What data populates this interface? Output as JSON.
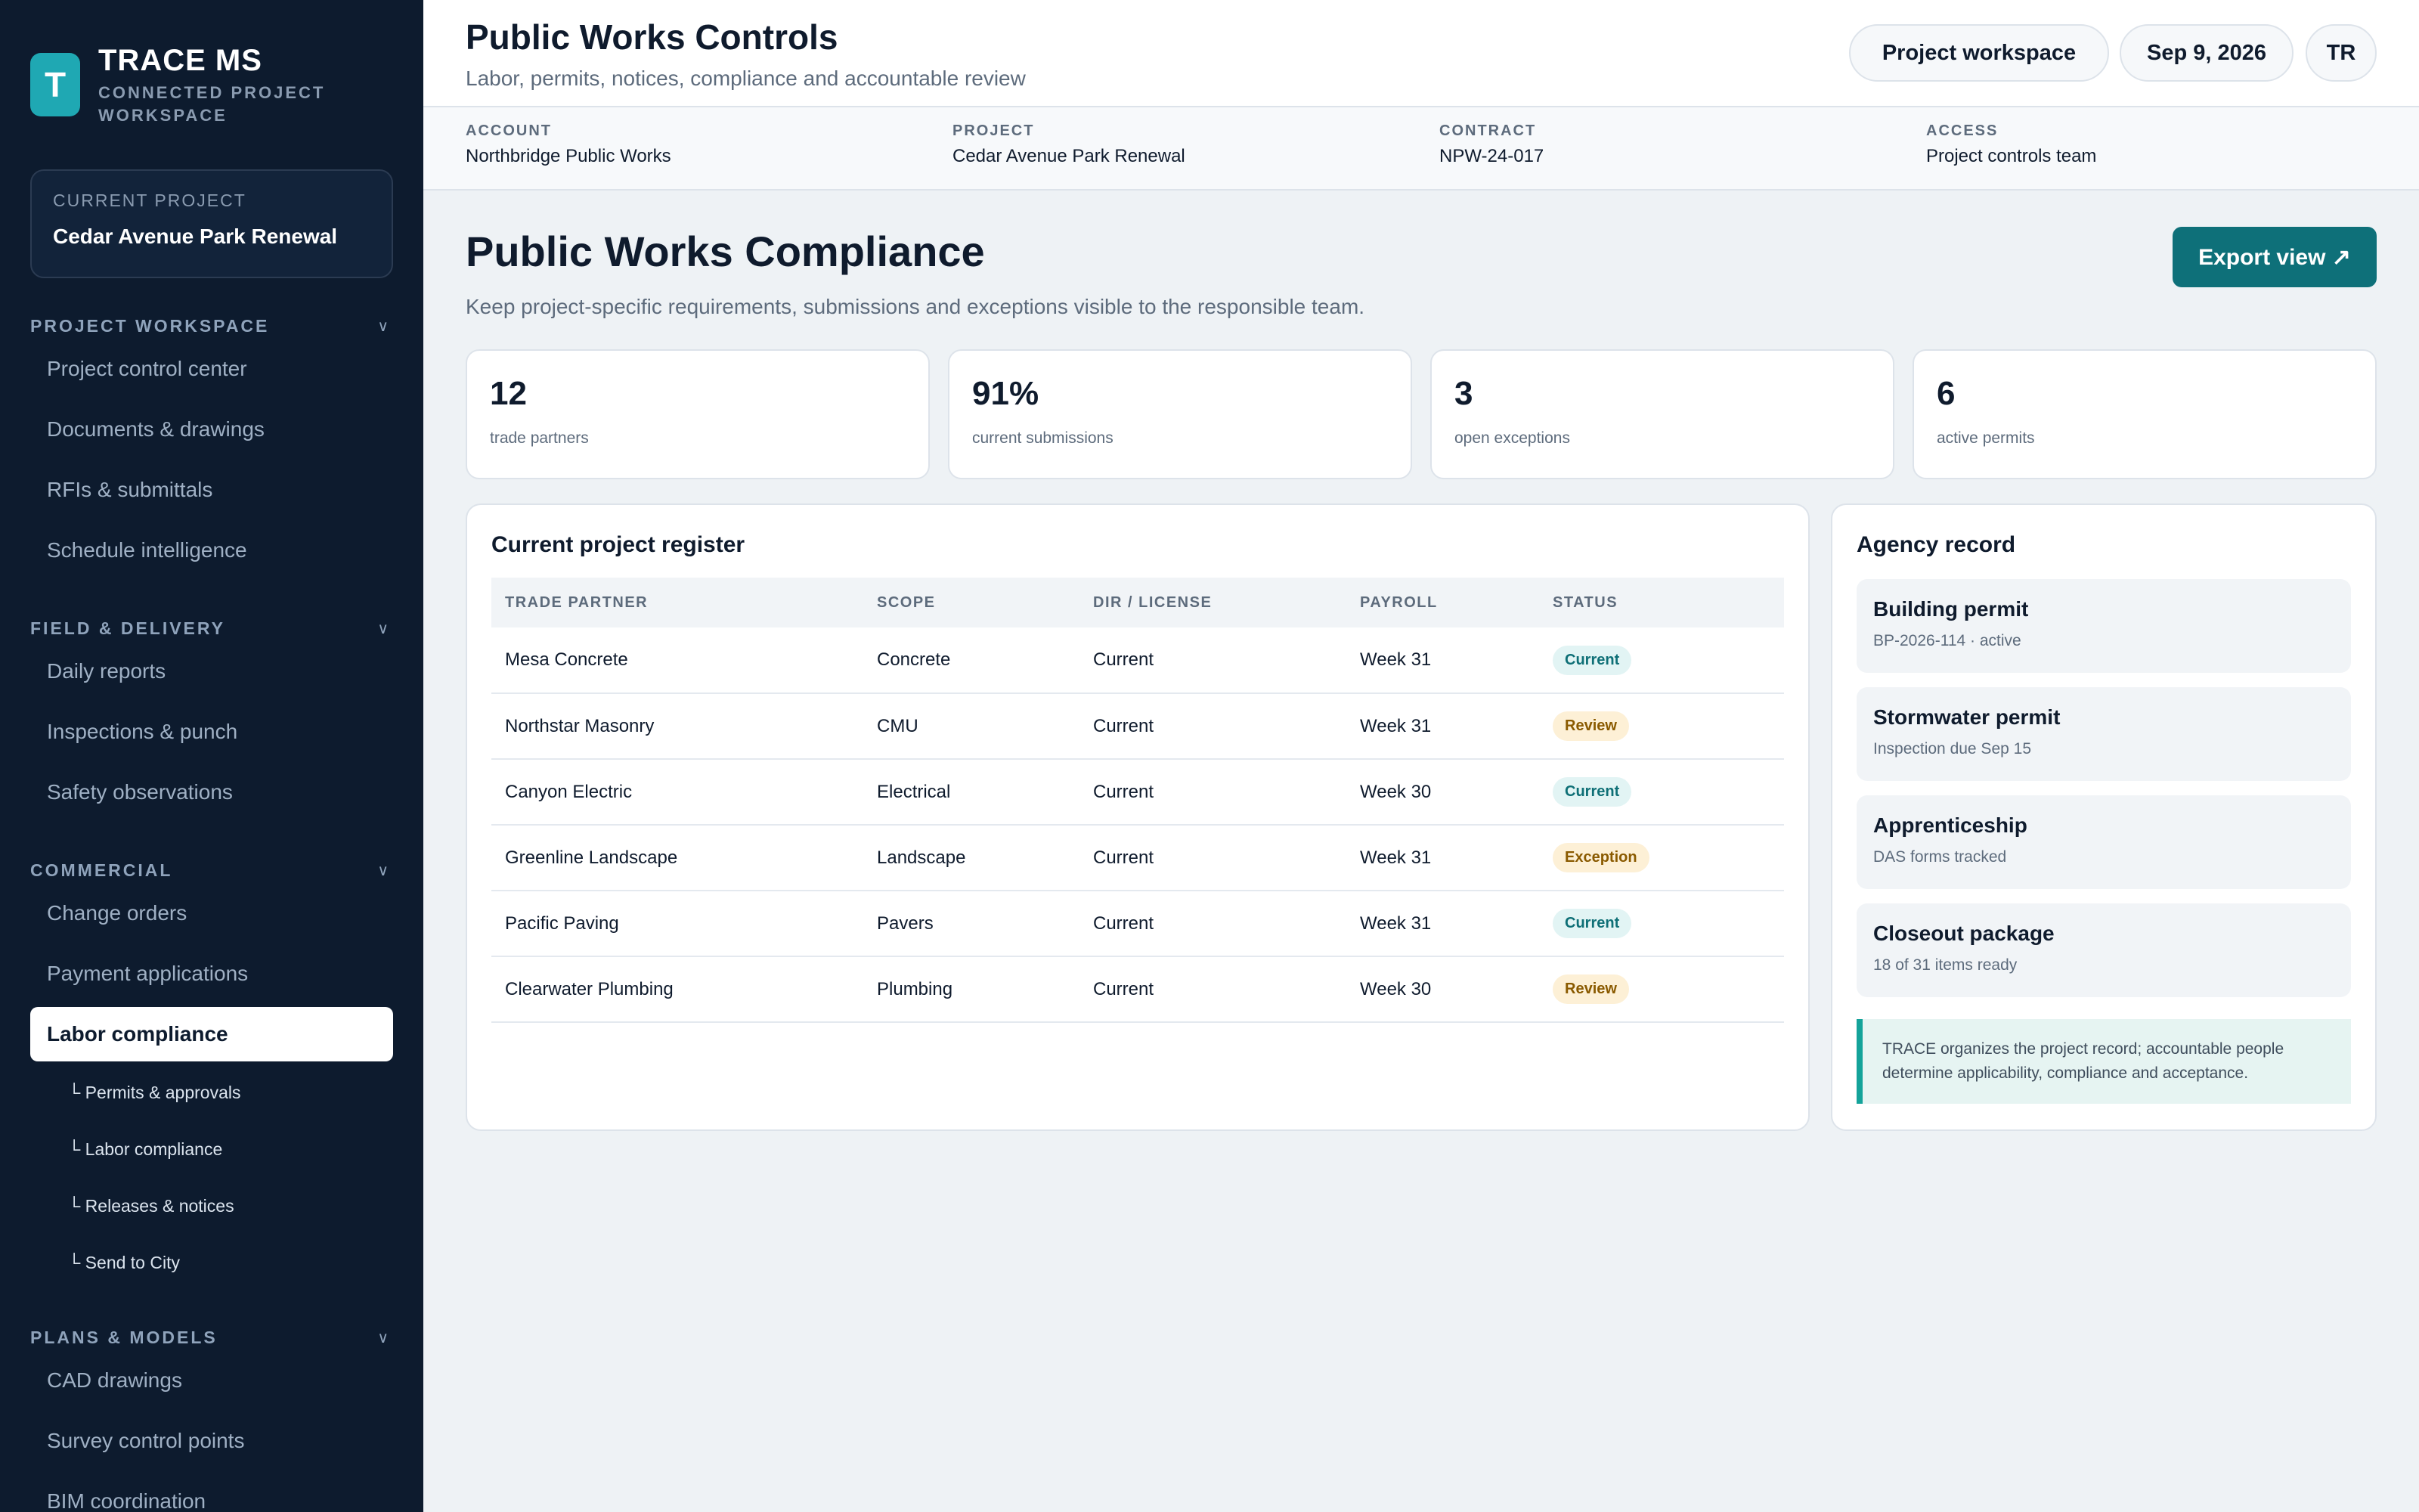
{
  "brand": {
    "logo_letter": "T",
    "name": "TRACE MS",
    "subtitle": "CONNECTED PROJECT WORKSPACE"
  },
  "current_project": {
    "label": "CURRENT PROJECT",
    "name": "Cedar Avenue Park Renewal"
  },
  "nav": {
    "workspace": {
      "title": "PROJECT WORKSPACE",
      "items": [
        "Project control center",
        "Documents & drawings",
        "RFIs & submittals",
        "Schedule intelligence"
      ]
    },
    "field": {
      "title": "FIELD & DELIVERY",
      "items": [
        "Daily reports",
        "Inspections & punch",
        "Safety observations"
      ]
    },
    "commercial": {
      "title": "COMMERCIAL",
      "items": [
        "Change orders",
        "Payment applications"
      ],
      "active": "Labor compliance",
      "sub": [
        "└ Permits & approvals",
        "└ Labor compliance",
        "└ Releases & notices",
        "└ Send to City"
      ]
    },
    "plans": {
      "title": "PLANS & MODELS",
      "items": [
        "CAD drawings",
        "Survey control points",
        "BIM coordination"
      ]
    },
    "chevron": "∨"
  },
  "header": {
    "title": "Public Works Controls",
    "subtitle": "Labor, permits, notices, compliance and accountable review",
    "workspace_pill": "Project workspace",
    "date_pill": "Sep 9, 2026",
    "avatar": "TR"
  },
  "meta": [
    {
      "key": "ACCOUNT",
      "value": "Northbridge Public Works"
    },
    {
      "key": "PROJECT",
      "value": "Cedar Avenue Park Renewal"
    },
    {
      "key": "CONTRACT",
      "value": "NPW-24-017"
    },
    {
      "key": "ACCESS",
      "value": "Project controls team"
    }
  ],
  "page": {
    "title": "Public Works Compliance",
    "description": "Keep project-specific requirements, submissions and exceptions visible to the responsible team.",
    "export_label": "Export view ↗"
  },
  "stats": [
    {
      "value": "12",
      "label": "trade partners"
    },
    {
      "value": "91%",
      "label": "current submissions"
    },
    {
      "value": "3",
      "label": "open exceptions"
    },
    {
      "value": "6",
      "label": "active permits"
    }
  ],
  "register": {
    "title": "Current project register",
    "columns": [
      "TRADE PARTNER",
      "SCOPE",
      "DIR / LICENSE",
      "PAYROLL",
      "STATUS"
    ],
    "rows": [
      [
        "Mesa Concrete",
        "Concrete",
        "Current",
        "Week 31",
        "Current"
      ],
      [
        "Northstar Masonry",
        "CMU",
        "Current",
        "Week 31",
        "Review"
      ],
      [
        "Canyon Electric",
        "Electrical",
        "Current",
        "Week 30",
        "Current"
      ],
      [
        "Greenline Landscape",
        "Landscape",
        "Current",
        "Week 31",
        "Exception"
      ],
      [
        "Pacific Paving",
        "Pavers",
        "Current",
        "Week 31",
        "Current"
      ],
      [
        "Clearwater Plumbing",
        "Plumbing",
        "Current",
        "Week 30",
        "Review"
      ]
    ]
  },
  "agency": {
    "title": "Agency record",
    "records": [
      {
        "title": "Building permit",
        "detail": "BP-2026-114 · active"
      },
      {
        "title": "Stormwater permit",
        "detail": "Inspection due Sep 15"
      },
      {
        "title": "Apprenticeship",
        "detail": "DAS forms tracked"
      },
      {
        "title": "Closeout package",
        "detail": "18 of 31 items ready"
      }
    ],
    "note": "TRACE organizes the project record; accountable people determine applicability, compliance and acceptance."
  },
  "colors": {
    "sidebar": "#0d1b2e",
    "accent": "#0e7079",
    "brand": "#1fa8b3"
  }
}
